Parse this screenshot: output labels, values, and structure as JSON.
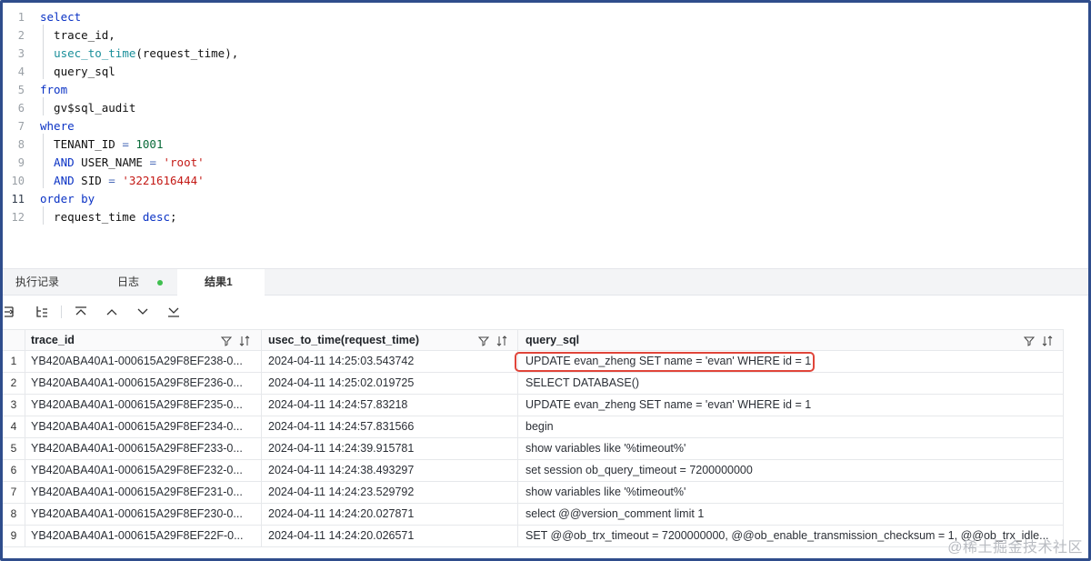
{
  "editor": {
    "line_numbers": [
      "1",
      "2",
      "3",
      "4",
      "5",
      "6",
      "7",
      "8",
      "9",
      "10",
      "11",
      "12"
    ],
    "lines": [
      [
        {
          "t": "select",
          "c": "kw"
        }
      ],
      [
        {
          "t": "  trace_id,",
          "c": "plain"
        }
      ],
      [
        {
          "t": "  ",
          "c": "plain"
        },
        {
          "t": "usec_to_time",
          "c": "fn"
        },
        {
          "t": "(request_time),",
          "c": "plain"
        }
      ],
      [
        {
          "t": "  query_sql",
          "c": "plain"
        }
      ],
      [
        {
          "t": "from",
          "c": "kw"
        }
      ],
      [
        {
          "t": "  gv$sql_audit",
          "c": "plain"
        }
      ],
      [
        {
          "t": "where",
          "c": "kw"
        }
      ],
      [
        {
          "t": "  TENANT_ID ",
          "c": "plain"
        },
        {
          "t": "=",
          "c": "op"
        },
        {
          "t": " ",
          "c": "plain"
        },
        {
          "t": "1001",
          "c": "num"
        }
      ],
      [
        {
          "t": "  AND",
          "c": "kw"
        },
        {
          "t": " USER_NAME ",
          "c": "plain"
        },
        {
          "t": "=",
          "c": "op"
        },
        {
          "t": " ",
          "c": "plain"
        },
        {
          "t": "'root'",
          "c": "str"
        }
      ],
      [
        {
          "t": "  AND",
          "c": "kw"
        },
        {
          "t": " SID ",
          "c": "plain"
        },
        {
          "t": "=",
          "c": "op"
        },
        {
          "t": " ",
          "c": "plain"
        },
        {
          "t": "'3221616444'",
          "c": "str"
        }
      ],
      [
        {
          "t": "order by",
          "c": "kw"
        }
      ],
      [
        {
          "t": "  request_time ",
          "c": "plain"
        },
        {
          "t": "desc",
          "c": "kw"
        },
        {
          "t": ";",
          "c": "plain"
        }
      ]
    ]
  },
  "tabs": {
    "history": "执行记录",
    "log": "日志",
    "result": "结果1"
  },
  "table": {
    "columns": [
      "trace_id",
      "usec_to_time(request_time)",
      "query_sql"
    ],
    "rows": [
      {
        "n": "1",
        "trace_id": "YB420ABA40A1-000615A29F8EF238-0...",
        "time": "2024-04-11 14:25:03.543742",
        "sql": "UPDATE evan_zheng SET name = 'evan' WHERE id = 1"
      },
      {
        "n": "2",
        "trace_id": "YB420ABA40A1-000615A29F8EF236-0...",
        "time": "2024-04-11 14:25:02.019725",
        "sql": "SELECT DATABASE()"
      },
      {
        "n": "3",
        "trace_id": "YB420ABA40A1-000615A29F8EF235-0...",
        "time": "2024-04-11 14:24:57.83218",
        "sql": "UPDATE evan_zheng SET name = 'evan' WHERE id = 1"
      },
      {
        "n": "4",
        "trace_id": "YB420ABA40A1-000615A29F8EF234-0...",
        "time": "2024-04-11 14:24:57.831566",
        "sql": "begin"
      },
      {
        "n": "5",
        "trace_id": "YB420ABA40A1-000615A29F8EF233-0...",
        "time": "2024-04-11 14:24:39.915781",
        "sql": "show variables like '%timeout%'"
      },
      {
        "n": "6",
        "trace_id": "YB420ABA40A1-000615A29F8EF232-0...",
        "time": "2024-04-11 14:24:38.493297",
        "sql": "set session ob_query_timeout = 7200000000"
      },
      {
        "n": "7",
        "trace_id": "YB420ABA40A1-000615A29F8EF231-0...",
        "time": "2024-04-11 14:24:23.529792",
        "sql": "show variables like '%timeout%'"
      },
      {
        "n": "8",
        "trace_id": "YB420ABA40A1-000615A29F8EF230-0...",
        "time": "2024-04-11 14:24:20.027871",
        "sql": "select @@version_comment limit 1"
      },
      {
        "n": "9",
        "trace_id": "YB420ABA40A1-000615A29F8EF22F-0...",
        "time": "2024-04-11 14:24:20.026571",
        "sql": "SET @@ob_trx_timeout = 7200000000, @@ob_enable_transmission_checksum = 1, @@ob_trx_idle..."
      }
    ]
  },
  "watermark": "@稀土掘金技术社区",
  "colors": {
    "highlight": "#e0453a",
    "frame": "#2f4d8c",
    "log_dot": "#3fbf4f"
  }
}
